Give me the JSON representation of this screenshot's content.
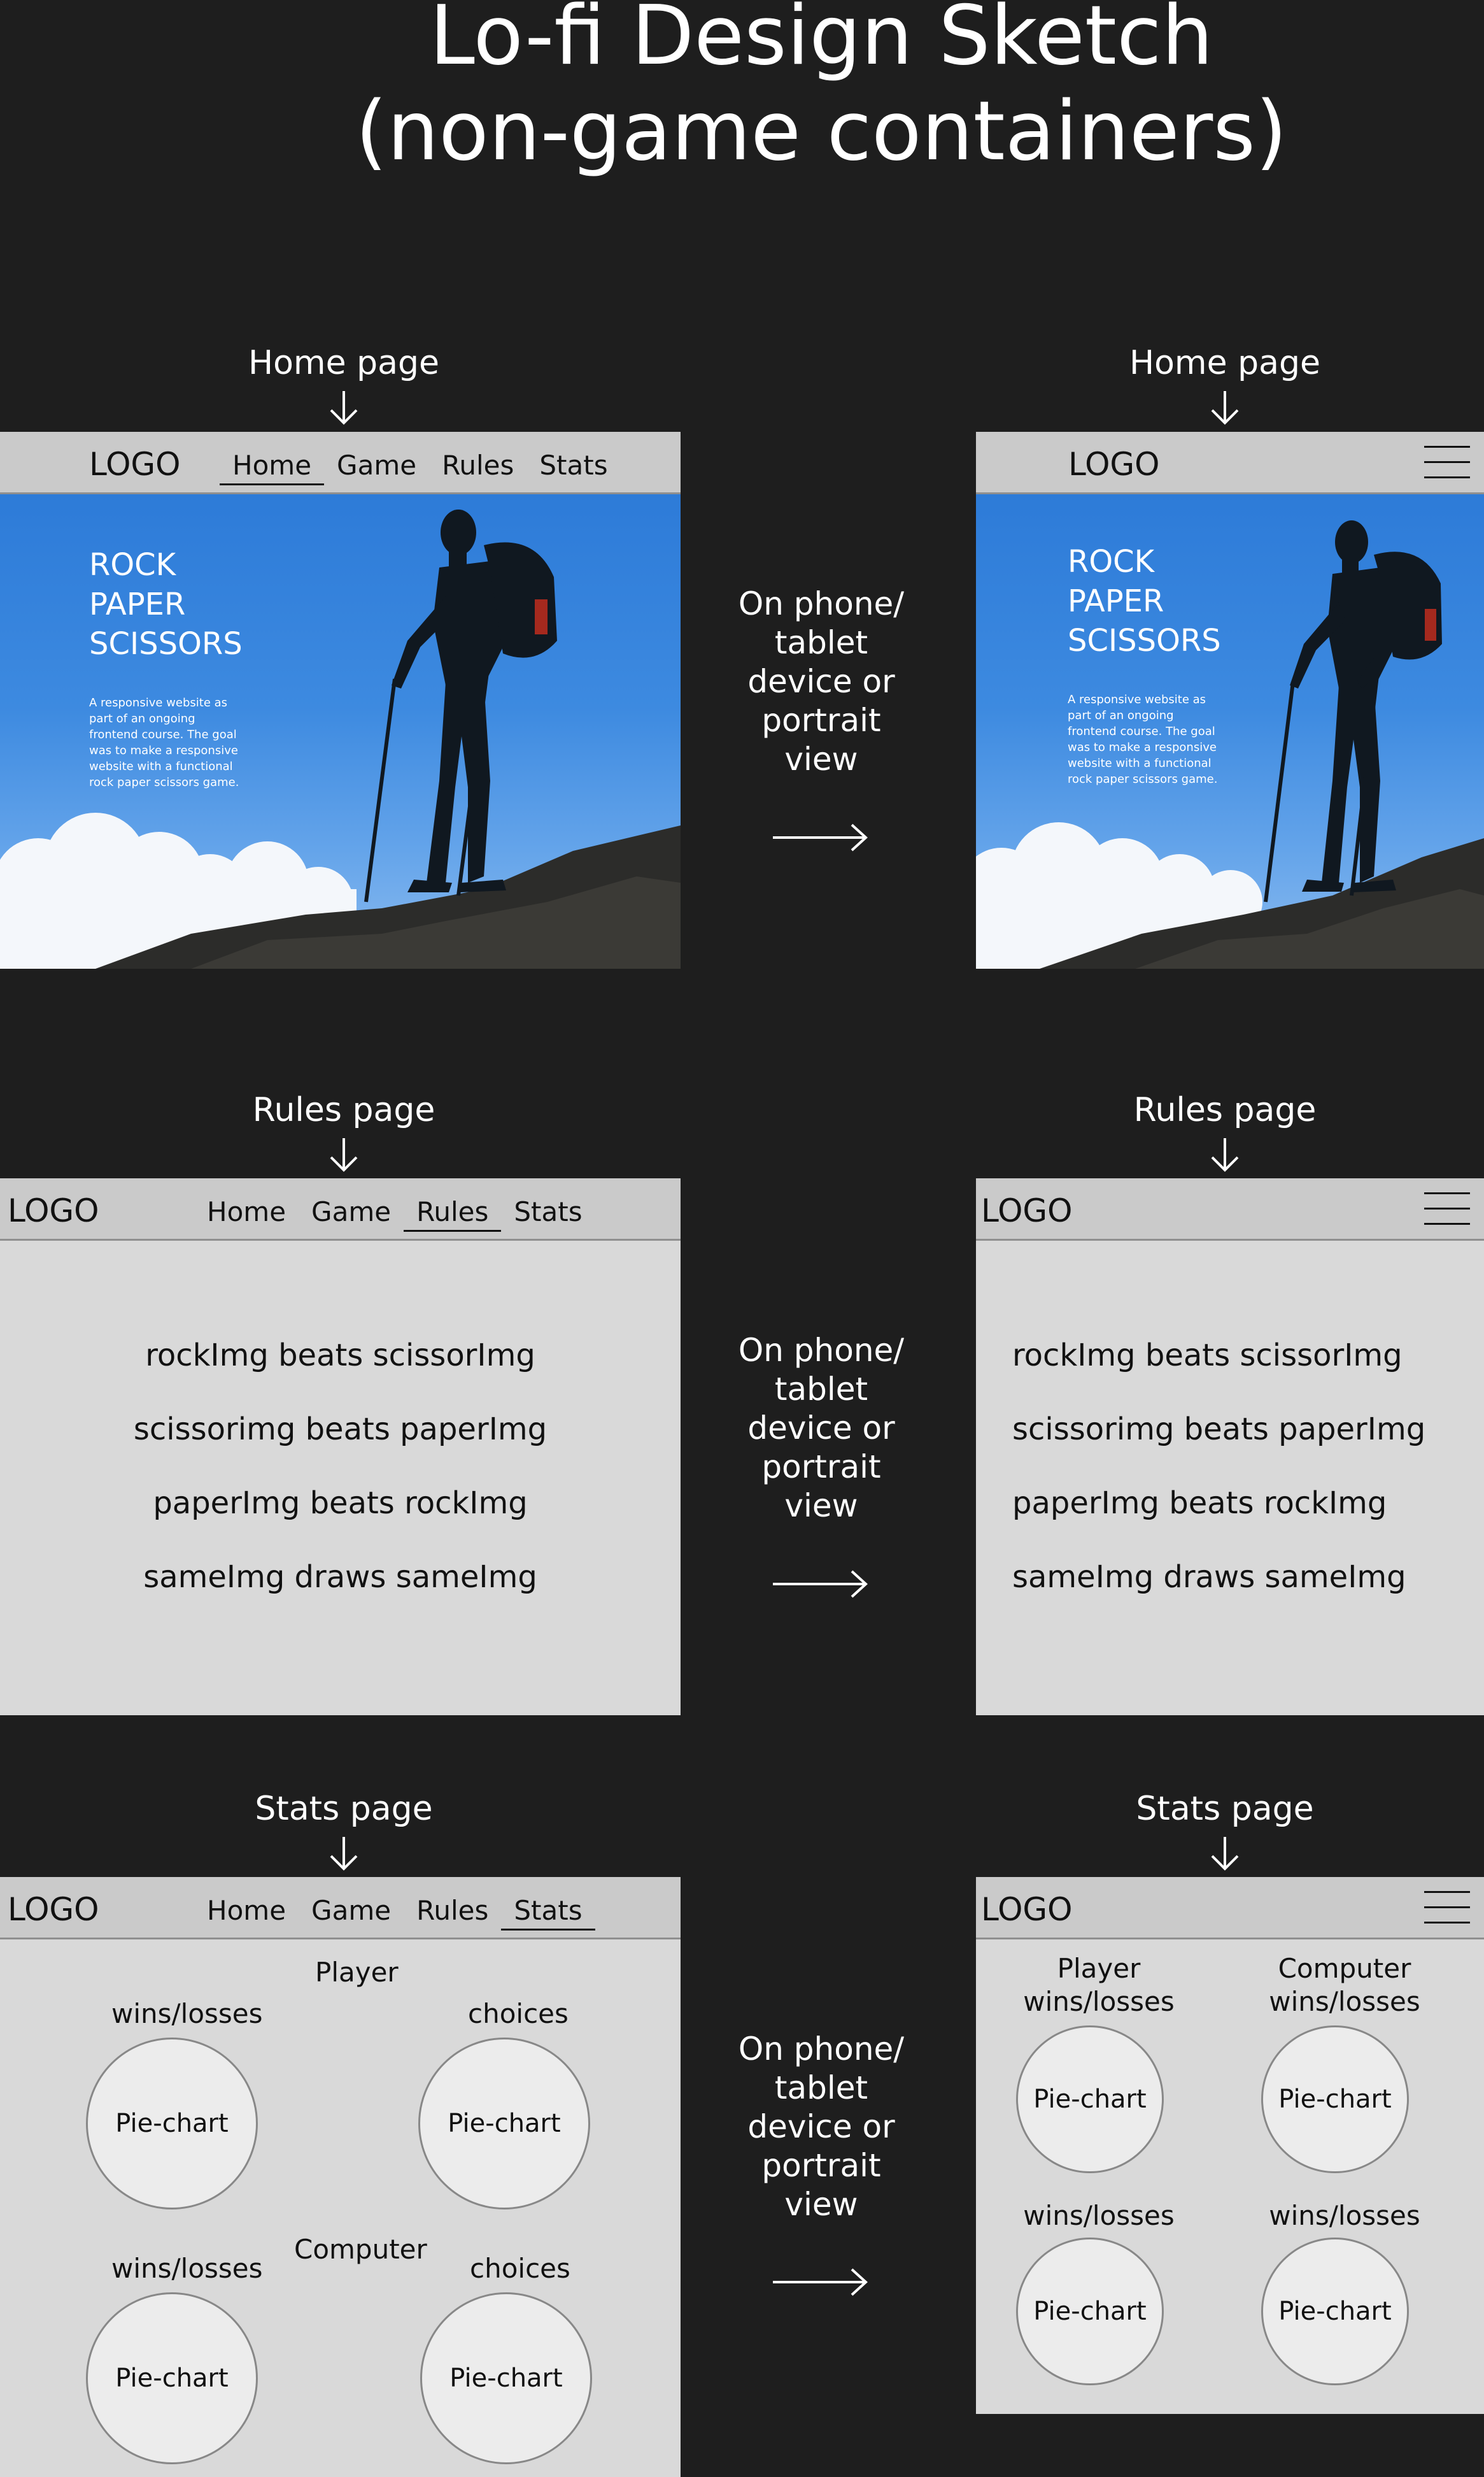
{
  "title": {
    "line1": "Lo-fi Design Sketch",
    "line2": "(non-game containers)"
  },
  "labels": {
    "home": "Home page",
    "rules": "Rules page",
    "stats": "Stats page"
  },
  "transition": [
    "On phone/",
    "tablet",
    "device or",
    "portrait",
    "view"
  ],
  "nav": {
    "logo": "LOGO",
    "links": [
      "Home",
      "Game",
      "Rules",
      "Stats"
    ]
  },
  "hero": {
    "title": [
      "ROCK",
      "PAPER",
      "SCISSORS"
    ],
    "description": [
      "A responsive website as",
      "part of an ongoing",
      "frontend course. The goal",
      "was to make a responsive",
      "website with a functional",
      "rock paper scissors game."
    ],
    "description_mobile": [
      "A responsive website as",
      "part of an ongoing",
      "frontend course. The goal",
      "was to make a responsive",
      "website with a functional",
      "rock paper scissors game."
    ]
  },
  "rules": [
    "rockImg beats scissorImg",
    "scissorimg beats paperImg",
    "paperImg beats rockImg",
    "sameImg draws sameImg"
  ],
  "stats": {
    "player": "Player",
    "computer": "Computer",
    "wins_losses": "wins/losses",
    "choices": "choices",
    "pie": "Pie-chart",
    "mobile_player": [
      "Player",
      "wins/losses"
    ],
    "mobile_computer": [
      "Computer",
      "wins/losses"
    ]
  },
  "colors": {
    "background": "#1e1e1e",
    "frame": "#d9d9d9",
    "navbar": "#cacaca",
    "sky": "#3d8ae0"
  }
}
